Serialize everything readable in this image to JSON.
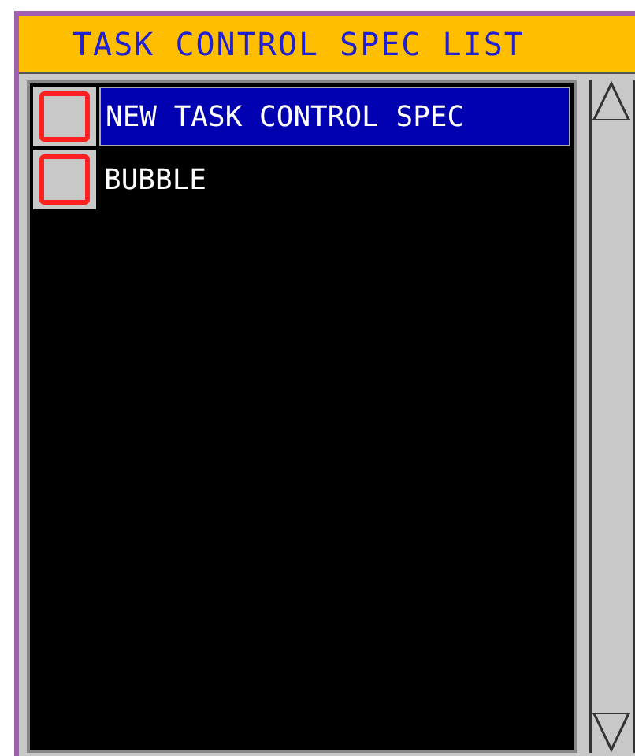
{
  "panel": {
    "title": "TASK CONTROL SPEC LIST"
  },
  "items": [
    {
      "label": "NEW TASK CONTROL SPEC",
      "selected": true,
      "checked": false
    },
    {
      "label": "BUBBLE",
      "selected": false,
      "checked": false
    }
  ]
}
